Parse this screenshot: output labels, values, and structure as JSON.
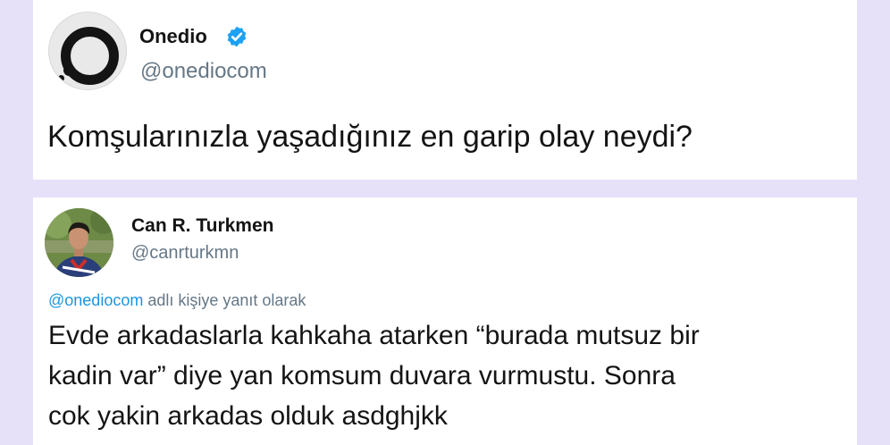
{
  "tweet": {
    "user": {
      "name": "Onedio",
      "handle": "@onediocom",
      "verified": true
    },
    "text": "Komşularınızla yaşadığınız en garip olay neydi?"
  },
  "reply": {
    "user": {
      "name": "Can R. Turkmen",
      "handle": "@canrturkmn"
    },
    "reply_to_mention": "@onediocom",
    "reply_to_suffix": " adlı kişiye yanıt olarak",
    "text_lines": [
      "Evde arkadaslarla kahkaha atarken “burada mutsuz bir",
      "kadin var” diye yan komsum duvara vurmustu. Sonra",
      "cok yakin arkadas olduk asdghjkk"
    ]
  },
  "colors": {
    "background": "#e6e0f8",
    "card": "#ffffff",
    "text": "#141414",
    "secondary": "#657786",
    "link": "#1b95e0",
    "verified": "#1da1f2"
  },
  "icons": [
    "verified-badge-icon"
  ]
}
